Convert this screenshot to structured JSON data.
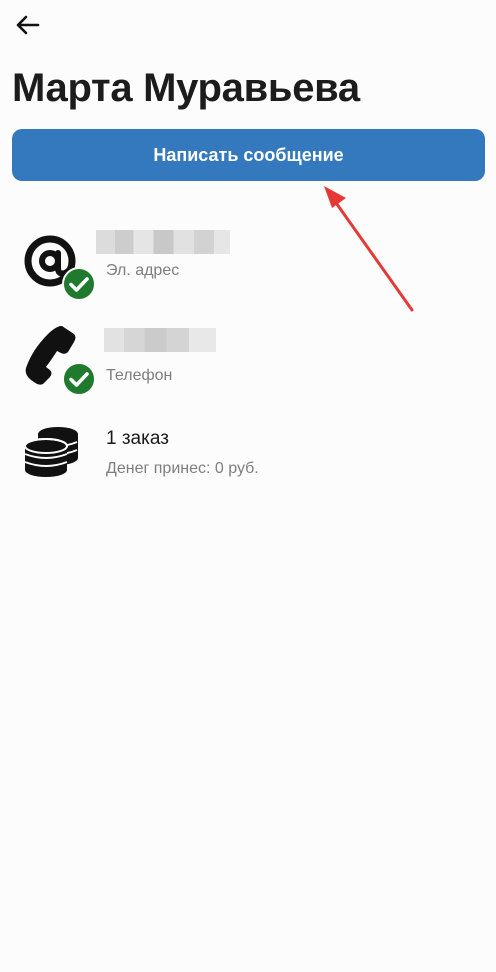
{
  "header": {
    "back_icon": "arrow-left-icon",
    "title": "Марта Муравьева"
  },
  "actions": {
    "message_button_label": "Написать сообщение"
  },
  "contacts": {
    "email": {
      "icon": "at-sign-icon",
      "verified_icon": "check-badge-icon",
      "value_hidden": true,
      "label": "Эл. адрес"
    },
    "phone": {
      "icon": "phone-icon",
      "verified_icon": "check-badge-icon",
      "value_hidden": true,
      "label": "Телефон"
    },
    "orders": {
      "icon": "coins-icon",
      "title": "1 заказ",
      "subtitle": "Денег принес: 0 руб."
    }
  },
  "colors": {
    "accent": "#3479bd",
    "verified": "#1f7a2e",
    "annotation_arrow": "#e53935"
  }
}
